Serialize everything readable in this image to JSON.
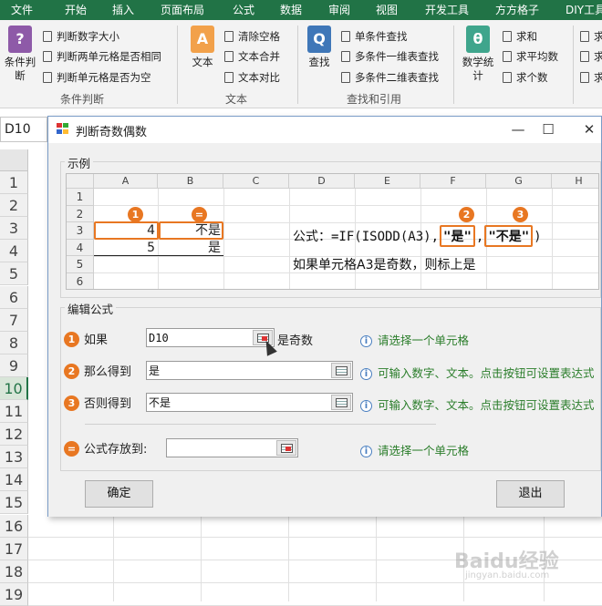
{
  "ribbon": {
    "tabs": [
      "文件",
      "开始",
      "插入",
      "页面布局",
      "公式",
      "数据",
      "审阅",
      "视图",
      "开发工具",
      "方方格子",
      "DIY工具"
    ],
    "groups": {
      "condition": {
        "big_label": "条件判断",
        "items": [
          "判断数字大小",
          "判断两单元格是否相同",
          "判断单元格是否为空"
        ],
        "group_label": "条件判断"
      },
      "text": {
        "big_label": "文本",
        "items": [
          "清除空格",
          "文本合并",
          "文本对比"
        ],
        "group_label": "文本"
      },
      "lookup": {
        "big_label": "查找",
        "items": [
          "单条件查找",
          "多条件一维表查找",
          "多条件二维表查找"
        ],
        "group_label": "查找和引用"
      },
      "stats": {
        "big_label": "数学统计",
        "items": [
          "求和",
          "求平均数",
          "求个数"
        ],
        "group_label": ""
      },
      "extra": {
        "items": [
          "求",
          "求",
          "求"
        ]
      }
    }
  },
  "namebox": "D10",
  "sheet_rows": [
    "1",
    "2",
    "3",
    "4",
    "5",
    "6",
    "7",
    "8",
    "9",
    "10",
    "11",
    "12",
    "13",
    "14",
    "15",
    "16",
    "17",
    "18",
    "19"
  ],
  "dialog": {
    "title": "判断奇数偶数",
    "controls": {
      "minimize": "—",
      "maximize": "☐",
      "close": "✕"
    },
    "example": {
      "legend": "示例",
      "columns": [
        "A",
        "B",
        "C",
        "D",
        "E",
        "F",
        "G",
        "H"
      ],
      "rows": [
        "1",
        "2",
        "3",
        "4",
        "5",
        "6"
      ],
      "cells": {
        "a3": "4",
        "b3": "不是",
        "a4": "5",
        "b4": "是"
      },
      "bubbles": {
        "one": "1",
        "eq": "=",
        "two": "2",
        "three": "3"
      },
      "formula": {
        "prefix": "公式：=IF(ISODD(A3),",
        "yes": "\"是\"",
        "comma": ",",
        "no": "\"不是\"",
        "suffix": ")"
      },
      "note": "如果单元格A3是奇数，则标上是"
    },
    "edit": {
      "legend": "编辑公式",
      "if_label": "如果",
      "if_value": "D10",
      "if_after": "是奇数",
      "if_hint": "请选择一个单元格",
      "then_label": "那么得到",
      "then_value": "是",
      "then_hint": "可输入数字、文本。点击按钮可设置表达式",
      "else_label": "否则得到",
      "else_value": "不是",
      "else_hint": "可输入数字、文本。点击按钮可设置表达式",
      "store_label": "公式存放到:",
      "store_value": "",
      "store_hint": "请选择一个单元格",
      "num1": "1",
      "num2": "2",
      "num3": "3",
      "numeq": "="
    },
    "buttons": {
      "ok": "确定",
      "exit": "退出"
    }
  },
  "watermark": {
    "main": "Baidu经验",
    "sub": "jingyan.baidu.com"
  },
  "colors": {
    "ribbon_green": "#217346",
    "accent_orange": "#e87722",
    "hint_green": "#2a7d2a"
  }
}
